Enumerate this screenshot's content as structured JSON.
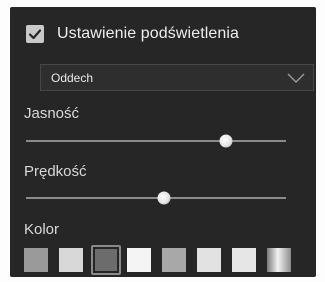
{
  "panel": {
    "header": {
      "checkbox_checked": true,
      "label": "Ustawienie podświetlenia"
    },
    "mode_select": {
      "value": "Oddech"
    },
    "brightness": {
      "label": "Jasność",
      "value_fraction": 0.77
    },
    "speed": {
      "label": "Prędkość",
      "value_fraction": 0.53
    },
    "color": {
      "label": "Kolor",
      "selected_index": 2,
      "swatches": [
        "#9a9a9a",
        "#d8d8d8",
        "#6c6c6c",
        "#f4f4f4",
        "#a8a8a8",
        "#e2e2e2",
        "#e6e6e6",
        "gradient"
      ]
    }
  },
  "colors": {
    "panel_bg": "#262626",
    "text": "#d8d8d8",
    "track": "#8a8a8a",
    "checkbox": "#c9c9c9"
  }
}
